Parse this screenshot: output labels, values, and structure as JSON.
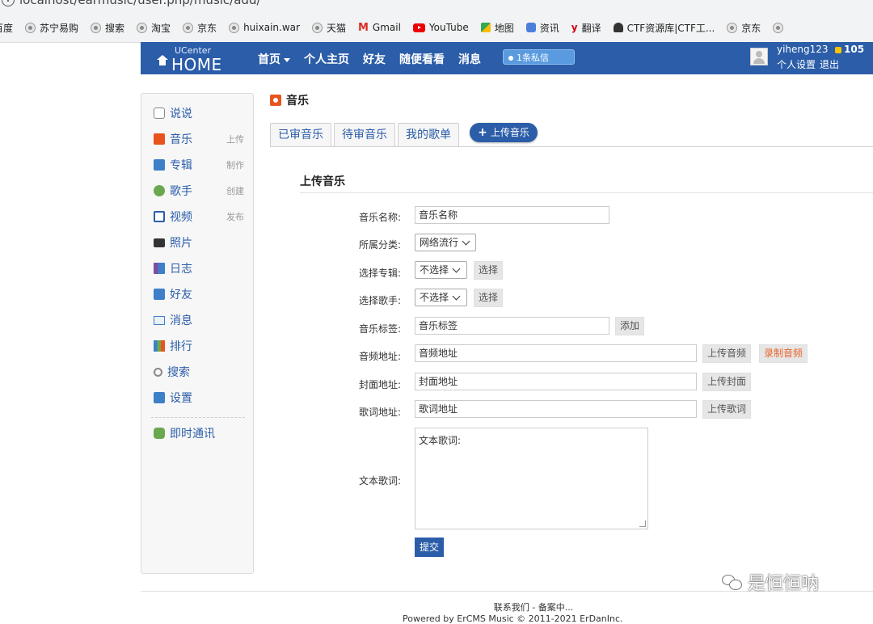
{
  "browser": {
    "url": "localhost/earmusic/user.php/music/add/",
    "bookmarks": [
      "百度",
      "苏宁易购",
      "搜索",
      "淘宝",
      "京东",
      "huixain.war",
      "天猫",
      "Gmail",
      "YouTube",
      "地图",
      "资讯",
      "翻译",
      "CTF资源库|CTF工...",
      "京东"
    ]
  },
  "header": {
    "logo_small": "UCenter",
    "logo_big": "HOME",
    "nav": [
      "首页",
      "个人主页",
      "好友",
      "随便看看",
      "消息"
    ],
    "message_badge": "1条私信",
    "username": "yiheng123",
    "coins": "105",
    "user_links": [
      "个人设置",
      "退出"
    ]
  },
  "sidebar": {
    "items": [
      {
        "label": "说说",
        "action": ""
      },
      {
        "label": "音乐",
        "action": "上传"
      },
      {
        "label": "专辑",
        "action": "制作"
      },
      {
        "label": "歌手",
        "action": "创建"
      },
      {
        "label": "视频",
        "action": "发布"
      },
      {
        "label": "照片",
        "action": ""
      },
      {
        "label": "日志",
        "action": ""
      },
      {
        "label": "好友",
        "action": ""
      },
      {
        "label": "消息",
        "action": ""
      },
      {
        "label": "排行",
        "action": ""
      },
      {
        "label": "搜索",
        "action": ""
      },
      {
        "label": "设置",
        "action": ""
      }
    ],
    "chat": "即时通讯"
  },
  "main": {
    "section_title": "音乐",
    "tabs": [
      "已审音乐",
      "待审音乐",
      "我的歌单"
    ],
    "upload_button": "上传音乐",
    "form_title": "上传音乐",
    "fields": {
      "name": {
        "label": "音乐名称:",
        "value": "音乐名称"
      },
      "category": {
        "label": "所属分类:",
        "value": "网络流行"
      },
      "album": {
        "label": "选择专辑:",
        "value": "不选择",
        "button": "选择"
      },
      "singer": {
        "label": "选择歌手:",
        "value": "不选择",
        "button": "选择"
      },
      "tags": {
        "label": "音乐标签:",
        "value": "音乐标签",
        "button": "添加"
      },
      "audio": {
        "label": "音频地址:",
        "value": "音频地址",
        "button": "上传音频",
        "button2": "录制音频"
      },
      "cover": {
        "label": "封面地址:",
        "value": "封面地址",
        "button": "上传封面"
      },
      "lyrics_url": {
        "label": "歌词地址:",
        "value": "歌词地址",
        "button": "上传歌词"
      },
      "lyrics_text": {
        "label": "文本歌词:",
        "value": "文本歌词:"
      }
    },
    "submit": "提交"
  },
  "footer": {
    "line1": "联系我们 - 备案中...",
    "line2": "Powered by ErCMS Music © 2011-2021 ErDanInc."
  },
  "watermark": "是恒恒呐",
  "colors": {
    "nav_blue": "#2b5da8",
    "link_blue": "#2b5da8",
    "orange": "#e8642a"
  }
}
